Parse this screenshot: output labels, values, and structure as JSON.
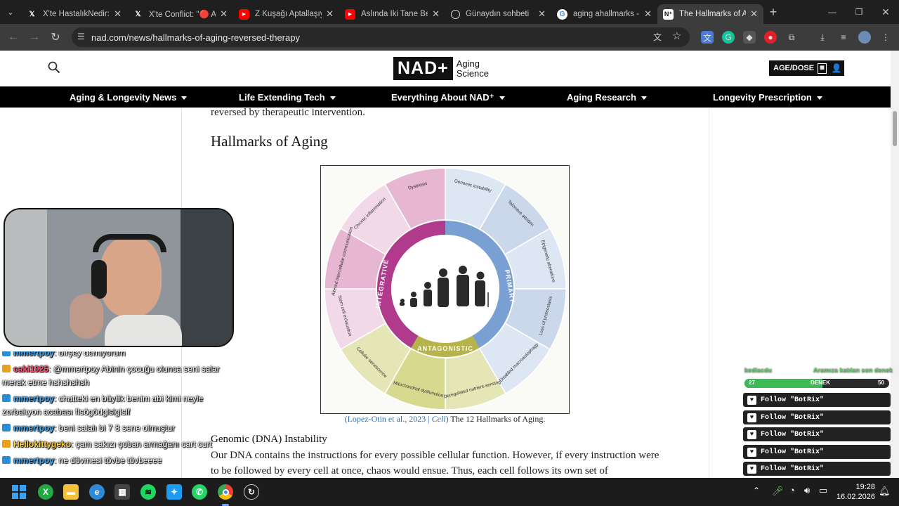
{
  "browser": {
    "tabs": [
      {
        "title": "X'te HastalıkNedir: \"I",
        "icon": "x-logo-icon"
      },
      {
        "title": "X'te Conflict: \"🔴 Al",
        "icon": "x-logo-icon"
      },
      {
        "title": "Z Kuşağı Aptallaşıyor",
        "icon": "youtube-icon"
      },
      {
        "title": "Aslında İki Tane Beyn",
        "icon": "youtube-icon"
      },
      {
        "title": "Günaydın sohbeti",
        "icon": "chatgpt-icon"
      },
      {
        "title": "aging ahallmarks - G",
        "icon": "google-icon"
      },
      {
        "title": "The Hallmarks of Agi",
        "icon": "nad-icon",
        "active": true
      }
    ],
    "url": "nad.com/news/hallmarks-of-aging-reversed-therapy"
  },
  "site": {
    "logo": {
      "mark": "NAD+",
      "line1": "Aging",
      "line2": "Science"
    },
    "agedose_label": "AGE/DOSE",
    "nav": [
      "Aging & Longevity News",
      "Life Extending Tech",
      "Everything About NAD⁺",
      "Aging Research",
      "Longevity Prescription"
    ]
  },
  "article": {
    "intro_tail": "reversed by therapeutic intervention.",
    "section_title": "Hallmarks of Aging",
    "figure": {
      "inner_ring": {
        "primary": "PRIMARY",
        "antagonistic": "ANTAGONISTIC",
        "integrative": "INTEGRATIVE"
      },
      "hallmarks": [
        "Genomic instability",
        "Telomere attrition",
        "Epigenetic alterations",
        "Loss of proteostasis",
        "Disabled macroautophagy",
        "Deregulated nutrient-sensing",
        "Mitochondrial dysfunction",
        "Cellular senescence",
        "Stem cell exhaustion",
        "Altered intercellular communication",
        "Chronic inflammation",
        "Dysbiosis"
      ],
      "colors": {
        "primary": "#7a9fd3",
        "antagonistic": "#b5b34a",
        "integrative": "#b03a8c"
      }
    },
    "caption": {
      "citation": "(Lopez-Otin et al., 2023 | ",
      "journal": "Cell",
      "close": ")",
      "text": " The 12 Hallmarks of Aging."
    },
    "subheading": "Genomic (DNA) Instability",
    "para_line1": "Our DNA contains the instructions for every possible cellular function. However, if every instruction were",
    "para_line2": "to be followed by every cell at once, chaos would ensue. Thus, each cell follows its own set of"
  },
  "stream": {
    "chat": [
      {
        "user": "mmertpoy",
        "msg": ": birşey demiyorum",
        "color": "#3fa9f5",
        "badge": "#2b8cd6"
      },
      {
        "user": "caki1925",
        "msg": ": @mmertpoy Abinin çocuğu olunca seni salar merak etme hshshshsh",
        "color": "#ff4d6d",
        "badge": "#e8a020"
      },
      {
        "user": "mmertpoy",
        "msg": ": chatteki en büyük benim abi kimi neyle zorbalıyon acabası flsögödglslglslf",
        "color": "#3fa9f5",
        "badge": "#2b8cd6"
      },
      {
        "user": "mmertpoy",
        "msg": ": beni salalı bi 7 8 sene olmuştur",
        "color": "#3fa9f5",
        "badge": "#2b8cd6"
      },
      {
        "user": "Hellokittygeko",
        "msg": ": çam sakızı çoban armağanı cart curt",
        "color": "#ffd23f",
        "badge": "#e8a020"
      },
      {
        "user": "mmertpoy",
        "msg": ": ne dövmesi tövbe tövbeeee",
        "color": "#3fa9f5",
        "badge": "#2b8cd6"
      }
    ],
    "goal": {
      "left_label": "kediacdu",
      "right_label": "Aramıza katılan son denek",
      "current": "27",
      "name": "DENEK",
      "target": "50",
      "progress": 0.54
    },
    "follow_label": "Follow \"BotRix\""
  },
  "taskbar": {
    "time": "19:28",
    "date": "16.02.2026"
  }
}
